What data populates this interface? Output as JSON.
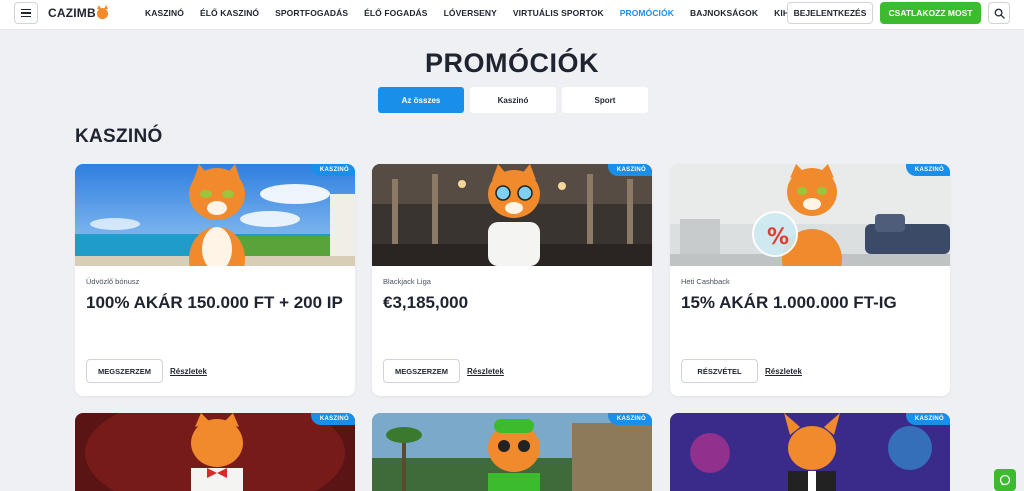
{
  "header": {
    "logo": "CAZIMB",
    "nav": [
      {
        "label": "KASZINÓ",
        "active": false
      },
      {
        "label": "ÉLŐ KASZINÓ",
        "active": false
      },
      {
        "label": "SPORTFOGADÁS",
        "active": false
      },
      {
        "label": "ÉLŐ FOGADÁS",
        "active": false
      },
      {
        "label": "LÓVERSENY",
        "active": false
      },
      {
        "label": "VIRTUÁLIS SPORTOK",
        "active": false
      },
      {
        "label": "PROMÓCIÓK",
        "active": true
      },
      {
        "label": "BAJNOKSÁGOK",
        "active": false
      },
      {
        "label": "KIHÍVÁSOK",
        "active": false
      }
    ],
    "login_label": "BEJELENTKEZÉS",
    "join_label": "CSATLAKOZZ MOST"
  },
  "page": {
    "title": "PROMÓCIÓK",
    "tabs": [
      {
        "label": "Az összes",
        "active": true
      },
      {
        "label": "Kaszinó",
        "active": false
      },
      {
        "label": "Sport",
        "active": false
      }
    ],
    "section_title": "KASZINÓ"
  },
  "cards": [
    {
      "badge": "KASZINÓ",
      "subtitle": "Üdvözlő bónusz",
      "title": "100% AKÁR 150.000 FT + 200 IP",
      "button": "MEGSZERZEM",
      "link": "Részletek"
    },
    {
      "badge": "KASZINÓ",
      "subtitle": "Blackjack Liga",
      "title": "€3,185,000",
      "button": "MEGSZERZEM",
      "link": "Részletek"
    },
    {
      "badge": "KASZINÓ",
      "subtitle": "Heti Cashback",
      "title": "15% AKÁR 1.000.000 FT-IG",
      "button": "RÉSZVÉTEL",
      "link": "Részletek"
    }
  ],
  "cards_row2": [
    {
      "badge": "KASZINÓ"
    },
    {
      "badge": "KASZINÓ"
    },
    {
      "badge": "KASZINÓ"
    }
  ],
  "colors": {
    "accent": "#1a8fea",
    "brand_green": "#3dbb2f",
    "cat_orange": "#f08a2c",
    "background": "#eef0f4"
  },
  "icons": [
    "hamburger-menu-icon",
    "cat-logo-icon",
    "search-icon",
    "chat-icon"
  ]
}
